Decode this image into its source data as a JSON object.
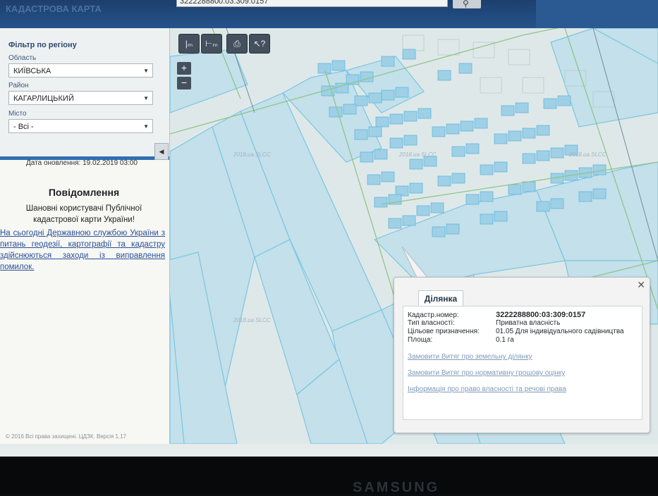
{
  "header": {
    "brand_text": "КАДАСТРОВА КАРТА",
    "search_value": "3222288800:03:309:0157",
    "search_icon": "search-icon"
  },
  "sidebar": {
    "filter_title": "Фільтр по регіону",
    "region_label": "Область",
    "region_value": "КИЇВСЬКА",
    "district_label": "Район",
    "district_value": "КАГАРЛИЦЬКИЙ",
    "city_label": "Місто",
    "city_value": "- Всі -",
    "update_date": "Дата оновлення: 19.02.2019 03:00",
    "notice_title": "Повідомлення",
    "greeting": "Шановні користувачі Публічної кадастрової карти України!",
    "notice_text": "На сьогодні Державною службою України з питань геодезії, картографії та кадастру здійснюються заходи із виправлення помилок.",
    "copyright": "© 2016 Всі права захищені. ЦДЗК. Версія 1.17"
  },
  "toolbar": {
    "zoom_in": "+",
    "zoom_out": "−",
    "print_icon": "printer-icon",
    "info_icon": "pointer-help-icon",
    "measure_icon": "ruler-icon",
    "area_icon": "area-measure-icon"
  },
  "map": {
    "watermark": "2018.ua SLCC"
  },
  "popup": {
    "tab_label": "Ділянка",
    "cadastral_label": "Кадастр.номер:",
    "cadastral_value": "3222288800:03:309:0157",
    "ownership_label": "Тип власності:",
    "ownership_value": "Приватна власність",
    "purpose_label": "Цільове призначення:",
    "purpose_value": "01.05 Для індивідуального садівництва",
    "area_label": "Площа:",
    "area_value": "0.1 га",
    "link1": "Замовити Витяг про земельну ділянку",
    "link2": "Замовити Витяг про нормативну грошову оцінку",
    "link3": "Інформація про право власності та речові права",
    "close_icon": "close-icon"
  },
  "monitor": {
    "brand": "SAMSUNG"
  },
  "colors": {
    "header": "#24528a",
    "accent": "#2e6fb4",
    "parcel_fill": "#b8dbe8",
    "parcel_stroke": "#6fc0e0",
    "link": "#2a5196"
  }
}
